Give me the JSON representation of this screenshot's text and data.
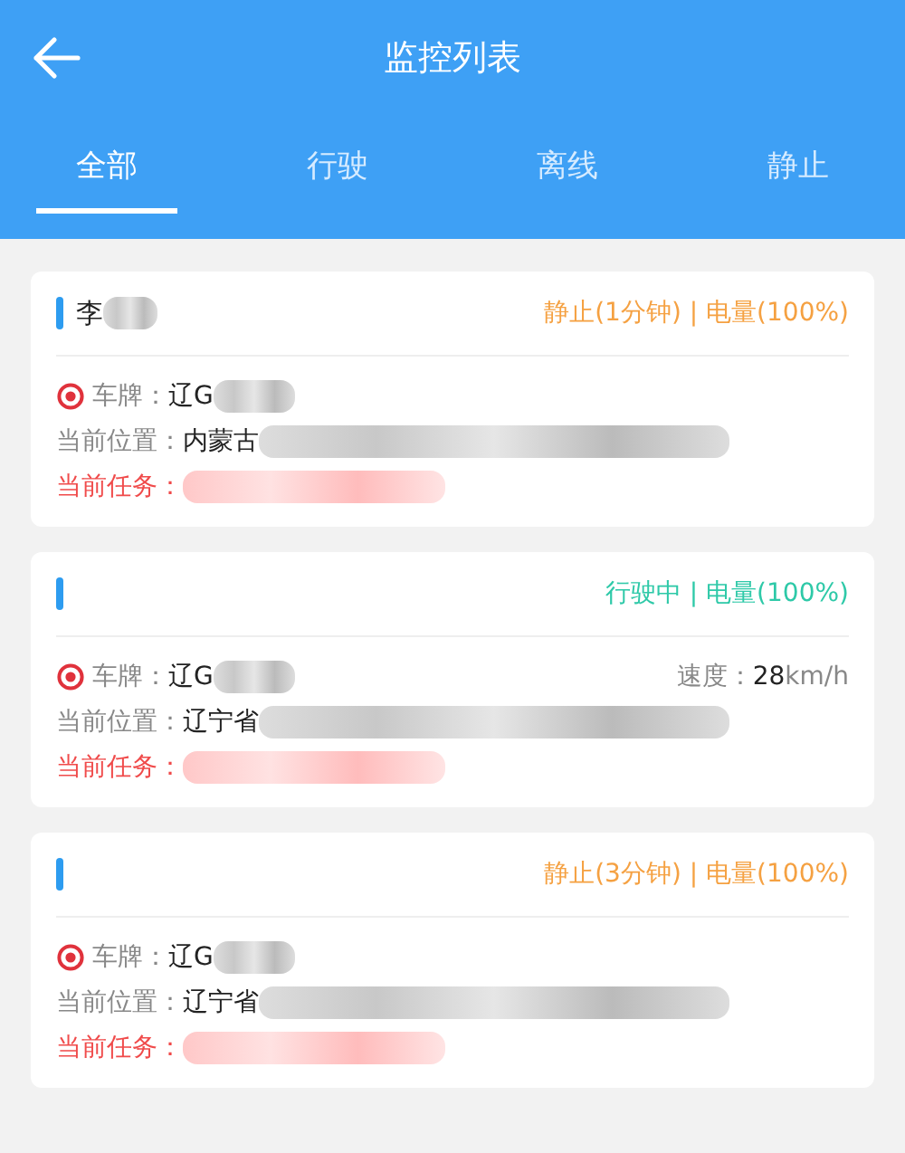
{
  "header": {
    "title": "监控列表"
  },
  "tabs": [
    {
      "label": "全部",
      "selected": true
    },
    {
      "label": "行驶",
      "selected": false
    },
    {
      "label": "离线",
      "selected": false
    },
    {
      "label": "静止",
      "selected": false
    }
  ],
  "vehicles": [
    {
      "name": "李",
      "kind": "stopped",
      "status": "静止(1分钟) | 电量(100%)",
      "plate_label": "车牌：",
      "plate": "辽G",
      "location_label": "当前位置：",
      "location": "内蒙古",
      "task_label": "当前任务："
    },
    {
      "kind": "driving",
      "status": "行驶中 | 电量(100%)",
      "plate_label": "车牌：",
      "plate": "辽G",
      "speed_label": "速度：",
      "speed": "28",
      "speed_unit": "km/h",
      "location_label": "当前位置：",
      "location": "辽宁省",
      "task_label": "当前任务："
    },
    {
      "kind": "stopped",
      "status": "静止(3分钟) | 电量(100%)",
      "plate_label": "车牌：",
      "plate": "辽G",
      "location_label": "当前位置：",
      "location": "辽宁省",
      "task_label": "当前任务："
    }
  ]
}
